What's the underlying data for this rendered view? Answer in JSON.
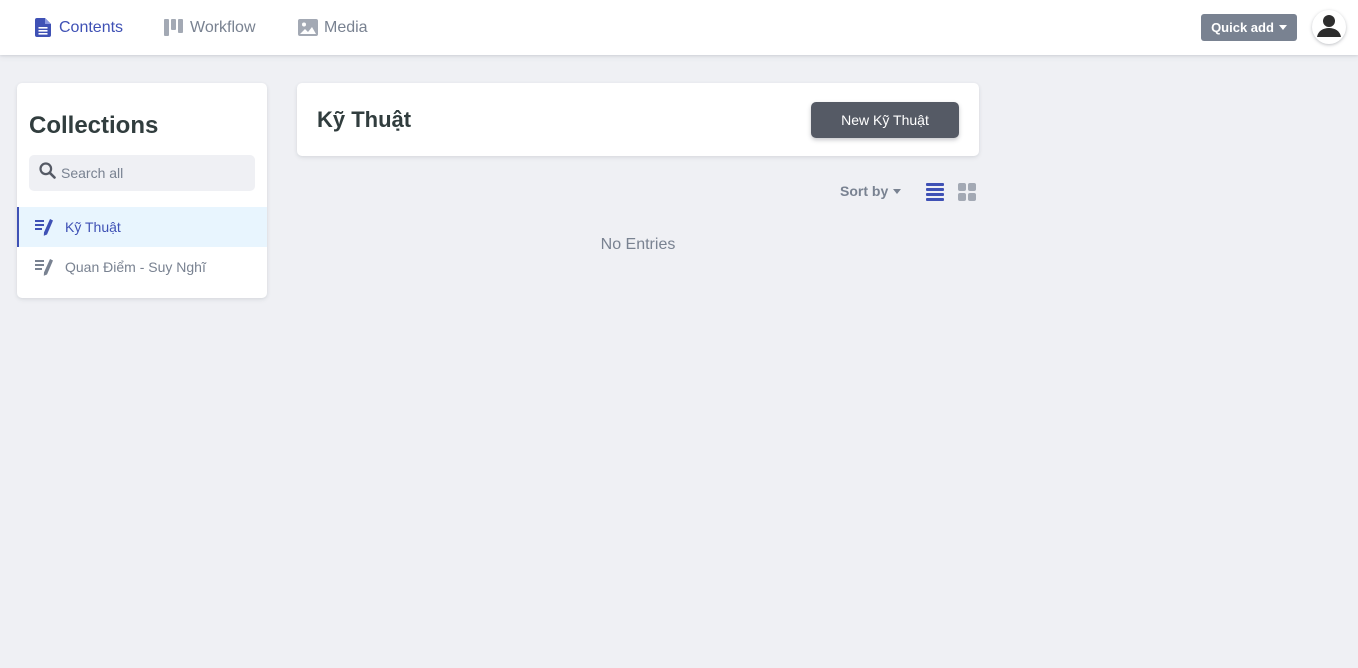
{
  "nav": {
    "items": [
      {
        "label": "Contents",
        "icon": "document-icon",
        "active": true
      },
      {
        "label": "Workflow",
        "icon": "kanban-icon",
        "active": false
      },
      {
        "label": "Media",
        "icon": "image-icon",
        "active": false
      }
    ],
    "quick_add": "Quick add"
  },
  "sidebar": {
    "title": "Collections",
    "search_placeholder": "Search all",
    "items": [
      {
        "label": "Kỹ Thuật",
        "icon": "edit-list-icon",
        "active": true
      },
      {
        "label": "Quan Điểm - Suy Nghĩ",
        "icon": "edit-list-icon",
        "active": false
      }
    ]
  },
  "main": {
    "title": "Kỹ Thuật",
    "new_button": "New Kỹ Thuật",
    "sort_by": "Sort by",
    "empty_text": "No Entries"
  },
  "colors": {
    "accent": "#3f51b5",
    "muted": "#798291",
    "background": "#eff0f4",
    "button_dark": "#555a65",
    "active_bg": "#e8f5fe"
  }
}
